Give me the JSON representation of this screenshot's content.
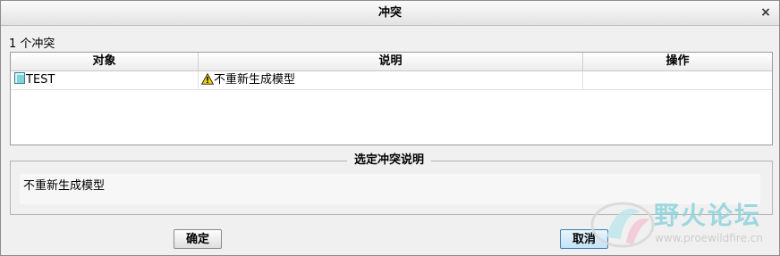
{
  "dialog": {
    "title": "冲突",
    "close_glyph": "×",
    "conflict_count": "1 个冲突"
  },
  "table": {
    "headers": [
      "对象",
      "说明",
      "操作"
    ],
    "rows": [
      {
        "object": "TEST",
        "description": "不重新生成模型",
        "action": ""
      }
    ]
  },
  "selected_description": {
    "group_label": "选定冲突说明",
    "text": "不重新生成模型"
  },
  "buttons": {
    "ok": "确定",
    "cancel": "取消"
  },
  "watermark": {
    "name": "野火论坛",
    "url": "www.proewildfire.cn"
  },
  "colors": {
    "accent_button": "#c4e3f6",
    "object_icon": "#7fd3db",
    "warning_icon": "#f5d20a"
  },
  "icons": {
    "object": "model-part-icon",
    "warning": "warning-triangle-icon",
    "close": "close-icon"
  }
}
